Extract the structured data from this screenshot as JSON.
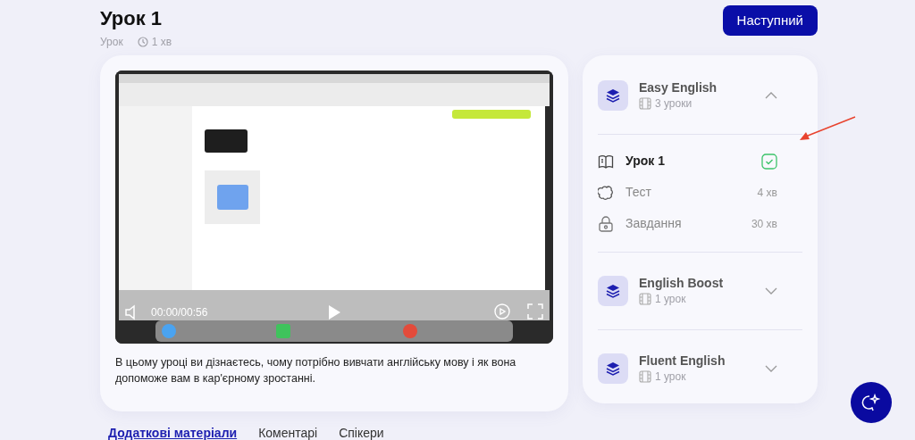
{
  "header": {
    "title": "Урок 1",
    "type_label": "Урок",
    "duration": "1 хв"
  },
  "next_button": "Наступний",
  "video": {
    "kind": "picture",
    "time": "00:00/00:56"
  },
  "description": "В цьому уроці ви дізнаєтесь, чому потрібно вивчати англійську мову і як вона допоможе вам в кар'єрному зростанні.",
  "courses": [
    {
      "title": "Easy English",
      "count": "3 уроки",
      "expanded": true,
      "lessons": [
        {
          "kind": "lesson",
          "title": "Урок 1",
          "selected": true,
          "checked": true
        },
        {
          "kind": "test",
          "title": "Тест",
          "duration": "4 хв",
          "selected": false
        },
        {
          "kind": "task",
          "title": "Завдання",
          "duration": "30 хв",
          "selected": false
        }
      ]
    },
    {
      "title": "English Boost",
      "count": "1 урок",
      "expanded": false
    },
    {
      "title": "Fluent English",
      "count": "1 урок",
      "expanded": false
    }
  ],
  "tabs": [
    {
      "label": "Додаткові матеріали",
      "selected": true
    },
    {
      "label": "Коментарі",
      "selected": false
    },
    {
      "label": "Спікери",
      "selected": false
    }
  ]
}
